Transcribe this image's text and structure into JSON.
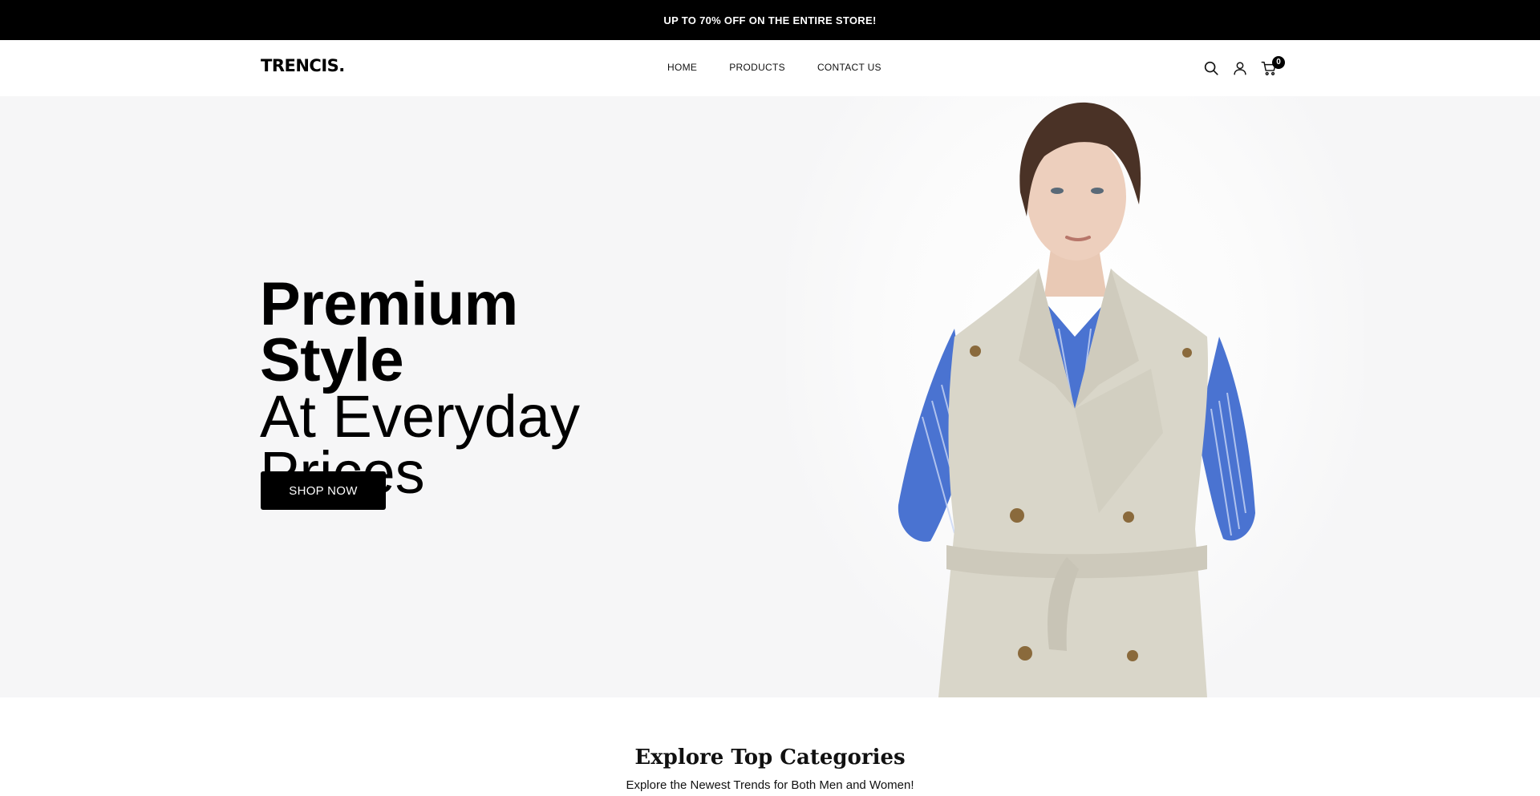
{
  "announcement": {
    "text": "UP TO 70% OFF ON THE ENTIRE STORE!"
  },
  "header": {
    "logo": "TRENCIS.",
    "nav": [
      {
        "label": "HOME"
      },
      {
        "label": "PRODUCTS"
      },
      {
        "label": "CONTACT US"
      }
    ],
    "icons": [
      "search-icon",
      "user-icon",
      "cart-icon"
    ],
    "cart_count": "0"
  },
  "hero": {
    "headline_line1": "Premium Style",
    "headline_line2": "At Everyday",
    "headline_line3": "Prices",
    "cta_label": "SHOP NOW",
    "image": "model-in-beige-trench-vest-and-blue-striped-shirt"
  },
  "categories": {
    "title": "Explore Top Categories",
    "subtitle": "Explore the Newest Trends for Both Men and Women!"
  },
  "colors": {
    "announcement_bg": "#000000",
    "hero_bg": "#f6f6f7",
    "button_bg": "#000000",
    "trench": "#d9d6c9",
    "shirt": "#4a73d1"
  }
}
